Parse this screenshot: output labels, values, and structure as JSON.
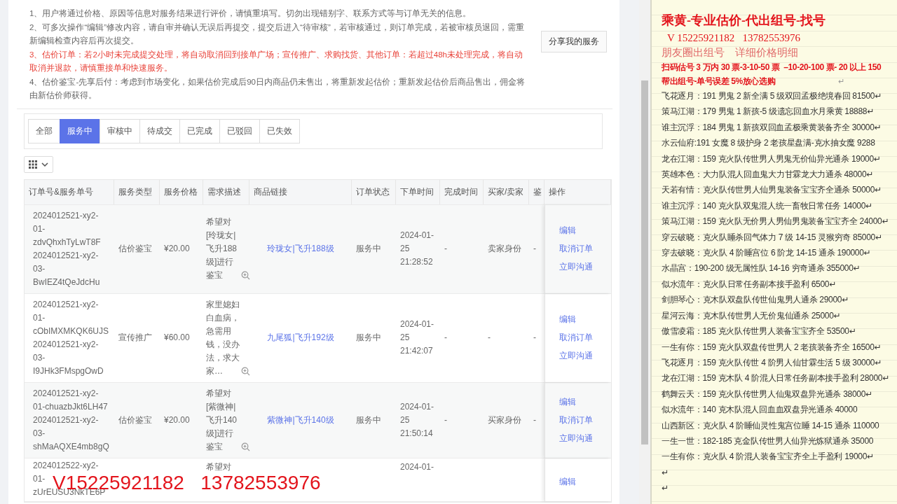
{
  "notice": {
    "lines": [
      {
        "text": "1、用户将通过价格、原因等信息对服务结果进行评价，请慎重填写。切勿出现错别字、联系方式等与订单无关的信息。",
        "kind": "normal"
      },
      {
        "text": "2、可多次操作“编辑”修改内容，请自审并确认无误后再提交，提交后进入“待审核”，若审核通过，则订单完成，若被审核员退回，需重新编辑检查内容后再次提交。",
        "kind": "normal"
      },
      {
        "text": "3、估价订单：若2小时未完成提交处理，将自动取消回到接单广场；宣传推广、求购找货、其他订单：若超过48h未处理完成，将自动取消并退款，请慎重接单和快速服务。",
        "kind": "warning"
      },
      {
        "text": "4、估价鉴宝-先享后付：考虑到市场变化，如果估价完成后90日内商品仍未售出，将重新发起估价；重新发起估价后商品售出，佣金将由新估价师获得。",
        "kind": "normal"
      }
    ],
    "share_button": "分享我的服务"
  },
  "tabs": [
    {
      "label": "全部",
      "selected": false
    },
    {
      "label": "服务中",
      "selected": true
    },
    {
      "label": "审核中",
      "selected": false
    },
    {
      "label": "待成交",
      "selected": false
    },
    {
      "label": "已完成",
      "selected": false
    },
    {
      "label": "已驳回",
      "selected": false
    },
    {
      "label": "已失效",
      "selected": false
    }
  ],
  "table": {
    "columns": [
      "订单号&服务单号",
      "服务类型",
      "服务价格",
      "需求描述",
      "商品链接",
      "订单状态",
      "下单时间",
      "完成时间",
      "买家/卖家",
      "鉴",
      "操作"
    ],
    "rows": [
      {
        "order_numbers": [
          "2024012521-xy2-",
          "01-",
          "zdvQhxhTyLwT8F",
          "2024012521-xy2-",
          "03-",
          "BwIEZ4tQeJdcHu"
        ],
        "type": "估价鉴宝",
        "price": "¥20.00",
        "description": "希望对[玲珑女|飞升188级]进行鉴宝",
        "link": "玲珑女|飞升188级",
        "status": "服务中",
        "order_time": "2024-01-25 21:28:52",
        "finish_time": "-",
        "role": "卖家身份",
        "column_10": "-",
        "actions": [
          "编辑",
          "取消订单",
          "立即沟通"
        ]
      },
      {
        "order_numbers": [
          "2024012521-xy2-",
          "01-",
          "cObIMXMKQK6UJS",
          "2024012521-xy2-",
          "03-",
          "I9JHk3FMspgOwD"
        ],
        "type": "宣传推广",
        "price": "¥60.00",
        "description": "家里媳妇白血病，急需用钱，没办法，求大家…",
        "link": "九尾狐|飞升192级",
        "status": "服务中",
        "order_time": "2024-01-25 21:42:07",
        "finish_time": "-",
        "role": "-",
        "column_10": "-",
        "actions": [
          "编辑",
          "取消订单",
          "立即沟通"
        ]
      },
      {
        "order_numbers": [
          "2024012521-xy2-",
          "01-chuazbJkt6LH47",
          "2024012521-xy2-",
          "03-",
          "shMaAQXE4mb8gQ"
        ],
        "type": "估价鉴宝",
        "price": "¥20.00",
        "description": "希望对[紫微神|飞升140级]进行鉴宝",
        "link": "紫微神|飞升140级",
        "status": "服务中",
        "order_time": "2024-01-25 21:50:14",
        "finish_time": "-",
        "role": "买家身份",
        "column_10": "-",
        "actions": [
          "编辑",
          "取消订单",
          "立即沟通"
        ]
      },
      {
        "order_numbers": [
          "2024012522-xy2-",
          "01-",
          "zUrEUSU3NkTE6P"
        ],
        "description": "希望对",
        "order_time": "2024-01-",
        "actions": [
          "编辑"
        ]
      }
    ]
  },
  "overlay_caption": "V15225921182   13782553976",
  "notes": {
    "title": "乘黄-专业估价-代出组号-找号",
    "phone": "V 15225921182   13782553976",
    "subtitle": "朋友圈出组号    详细价格明细",
    "pricing": [
      {
        "text": "扫码估号 3 万内 30 票-3-10-50 票  –10-20-100 票- 20 以上 150"
      },
      {
        "text": "帮出组号-单号误差 5%放心选购",
        "pilcrow": "↵"
      }
    ],
    "entries": [
      "飞花逐月：191 男鬼 2 新全满 5 级双回孟极绝境春回 81500↵",
      "策马江湖：179 男鬼 1 新孩-5 级遗忘回血水月乘黄 18888↵",
      "谁主沉浮：184 男鬼 1 新孩双回血孟极乘黄装备齐全 30000↵",
      "水云仙府:191 女魔 8 级护身 2 老孩星盘满-克水抽女魔 9288",
      "龙在江湖：159 克火队传世男人男鬼无价仙异光通杀 19000↵",
      "英雄本色：大力队混人回血鬼大力甘霖龙大力通杀 48000↵",
      "天若有情：克火队传世男人仙男鬼装备宝宝齐全通杀 50000↵",
      "谁主沉浮：140 克火队双鬼混人统一畜牧日常任务 14000↵",
      "策马江湖：159 克火队无价男人男仙男鬼装备宝宝齐全 24000↵",
      "穿云破晓：克火队睡杀回气体力 7 级 14-15 灵猴穷奇 85000↵",
      "穿去破晓：克火队 4 阶睡宫位 6 阶龙 14-15 通杀 190000↵",
      "水晶宫：190-200 级无属性队 14-16 穷奇通杀 355000↵",
      "似水流年：克火队日常任务副本接手盈利 6500↵",
      "剑胆琴心：克木队双盘队传世仙鬼男人通杀 29000↵",
      "星河云海：克木队传世男人无价鬼仙通杀 25000↵",
      "傲雪凌霜：185 克火队传世男人装备宝宝齐全 53500↵",
      "一生有你：159 克火队双盘传世男人 2 老孩装备齐全 16500↵",
      "飞花逐月：159 克火队传世 4 阶男人仙甘霖生活 5 级 30000↵",
      "龙在江湖：159 克木队 4 阶混人日常任务副本接手盈利 28000↵",
      "鹤舞云天：159 克火队传世男人仙鬼双盘异光通杀 38000↵",
      "似水流年：140 克木队混人回血血双盘异光通杀 40000",
      "山西新区：克火队 4 阶睡仙灵性鬼宫位睡 14-15 通杀 110000",
      "一生一世：182-185 克金队传世男人仙异光炼狱通杀 35000",
      "一生有你：克火队 4 阶混人装备宝宝齐全上手盈利 19000↵",
      "↵",
      "↵"
    ]
  }
}
